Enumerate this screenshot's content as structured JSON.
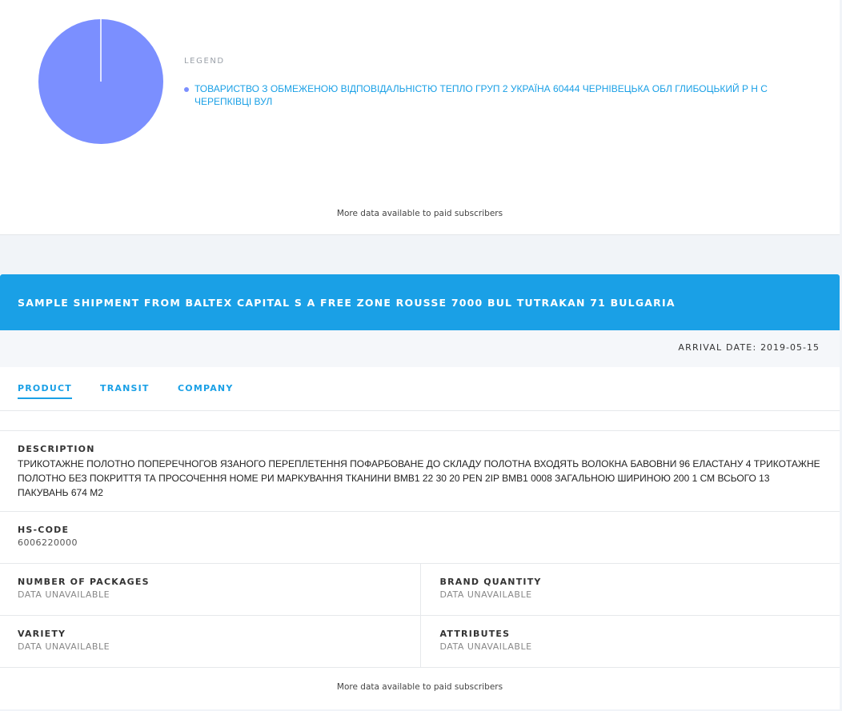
{
  "top_card": {
    "legend_title": "LEGEND",
    "legend_items": [
      {
        "label": "ТОВАРИСТВО З ОБМЕЖЕНОЮ ВІДПОВІДАЛЬНІСТЮ ТЕПЛО ГРУП 2 УКРАЇНА 60444 ЧЕРНІВЕЦЬКА ОБЛ ГЛИБОЦЬКИЙ Р Н С ЧЕРЕПКІВЦІ ВУЛ",
        "color": "#7b8fff"
      }
    ],
    "note": "More data available to paid subscribers"
  },
  "chart_data": {
    "type": "pie",
    "slices": [
      {
        "label": "ТОВАРИСТВО З ОБМЕЖЕНОЮ ВІДПОВІДАЛЬНІСТЮ ТЕПЛО ГРУП 2 УКРАЇНА 60444 ЧЕРНІВЕЦЬКА ОБЛ ГЛИБОЦЬКИЙ Р Н С ЧЕРЕПКІВЦІ ВУЛ",
        "value": 100,
        "color": "#7b8fff"
      }
    ],
    "legend": "right"
  },
  "shipment": {
    "title": "SAMPLE SHIPMENT FROM BALTEX CAPITAL S A FREE ZONE ROUSSE 7000 BUL TUTRAKAN 71 BULGARIA",
    "arrival_label": "ARRIVAL DATE:",
    "arrival_date": "2019-05-15",
    "header_color": "#1aa0e6",
    "tabs": [
      {
        "label": "PRODUCT",
        "active": true
      },
      {
        "label": "TRANSIT",
        "active": false
      },
      {
        "label": "COMPANY",
        "active": false
      }
    ],
    "description_label": "DESCRIPTION",
    "description": "ТРИКОТАЖНЕ ПОЛОТНО ПОПЕРЕЧНОГОВ ЯЗАНОГО ПЕРЕПЛЕТЕННЯ ПОФАРБОВАНЕ ДО СКЛАДУ ПОЛОТНА ВХОДЯТЬ ВОЛОКНА БАВОВНИ 96 ЕЛАСТАНУ 4 ТРИКОТАЖНЕ ПОЛОТНО БЕЗ ПОКРИТТЯ ТА ПРОСОЧЕННЯ НОМЕ РИ МАРКУВАННЯ ТКАНИНИ BMB1 22 30 20 PEN 2IP BMB1 0008 ЗАГАЛЬНОЮ ШИРИНОЮ 200 1 СМ ВСЬОГО 13 ПАКУВАНЬ 674 М2",
    "hs_label": "HS-CODE",
    "hs_value": "6006220000",
    "packages_label": "NUMBER OF PACKAGES",
    "packages_value": "DATA UNAVAILABLE",
    "brand_label": "BRAND QUANTITY",
    "brand_value": "DATA UNAVAILABLE",
    "variety_label": "VARIETY",
    "variety_value": "DATA UNAVAILABLE",
    "attributes_label": "ATTRIBUTES",
    "attributes_value": "DATA UNAVAILABLE",
    "note": "More data available to paid subscribers"
  }
}
